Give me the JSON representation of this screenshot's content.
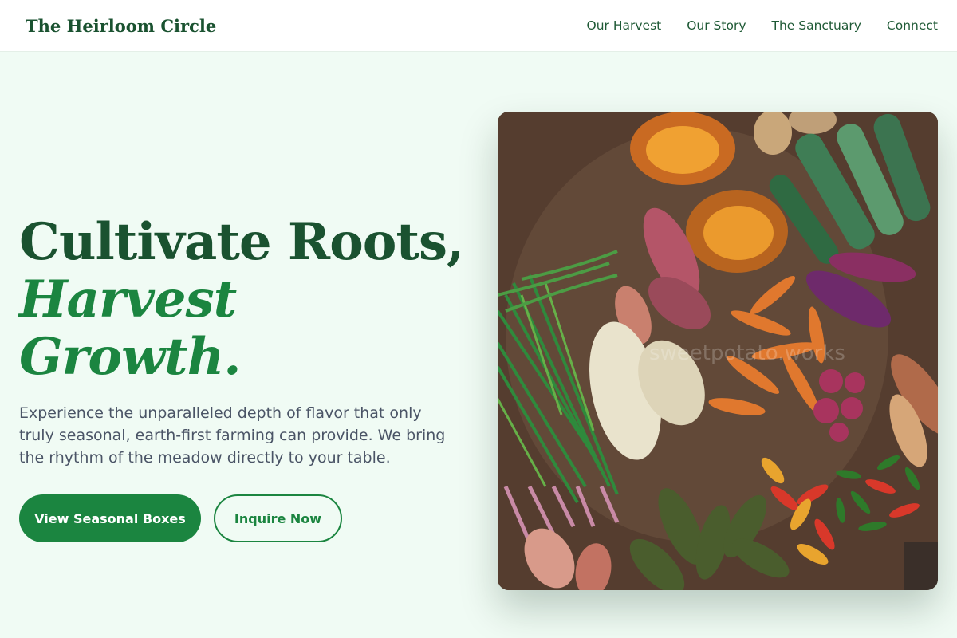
{
  "brand": "The Heirloom Circle",
  "nav": [
    "Our Harvest",
    "Our Story",
    "The Sanctuary",
    "Connect"
  ],
  "hero": {
    "title_line1": "Cultivate Roots,",
    "title_line2": "Harvest Growth.",
    "description": "Experience the unparalleled depth of flavor that only truly seasonal, earth-first farming can provide. We bring the rhythm of the meadow directly to your table.",
    "primary_cta": "View Seasonal Boxes",
    "secondary_cta": "Inquire Now",
    "image_watermark": "sweetpotato.works"
  },
  "colors": {
    "brand_green": "#1a5230",
    "accent_green": "#1b8540",
    "page_background": "#f0fbf4",
    "body_text": "#4a5466"
  }
}
